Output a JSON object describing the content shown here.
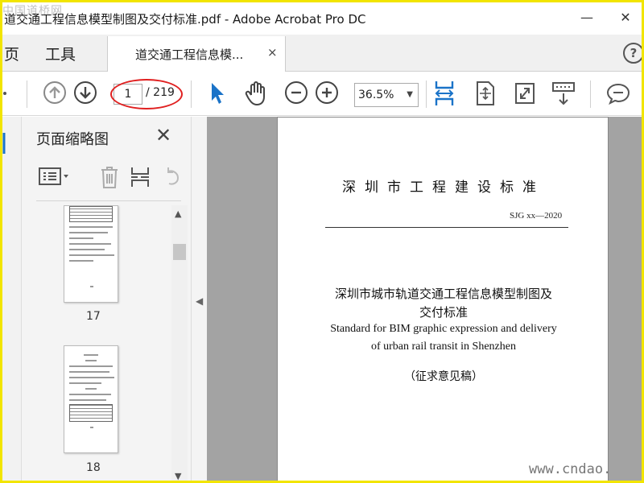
{
  "window": {
    "title": "道交通工程信息模型制图及交付标准.pdf - Adobe Acrobat Pro DC",
    "minimize": "—",
    "close": "✕"
  },
  "watermark_top": "中国道桥网",
  "watermark_bottom": "www.cndao.",
  "tabs": {
    "home": "页",
    "tools": "工具",
    "doc_tab": "道交通工程信息模...",
    "doc_close": "×",
    "help": "?"
  },
  "toolbar": {
    "current_page": "1",
    "total_pages": "/ 219",
    "zoom": "36.5%"
  },
  "panel": {
    "title": "页面缩略图",
    "close": "✕",
    "thumbnails": [
      {
        "label": "17"
      },
      {
        "label": "18"
      }
    ]
  },
  "document": {
    "header": "深圳市工程建设标准",
    "code": "SJG xx—2020",
    "title_cn_line1": "深圳市城市轨道交通工程信息模型制图及",
    "title_cn_line2": "交付标准",
    "title_en_line1": "Standard for BIM graphic expression and delivery",
    "title_en_line2": "of urban rail transit in Shenzhen",
    "draft": "（征求意见稿）"
  },
  "colors": {
    "frame_border": "#f2e500",
    "highlight_ellipse": "#e02020",
    "accent_blue": "#1a73c8"
  }
}
